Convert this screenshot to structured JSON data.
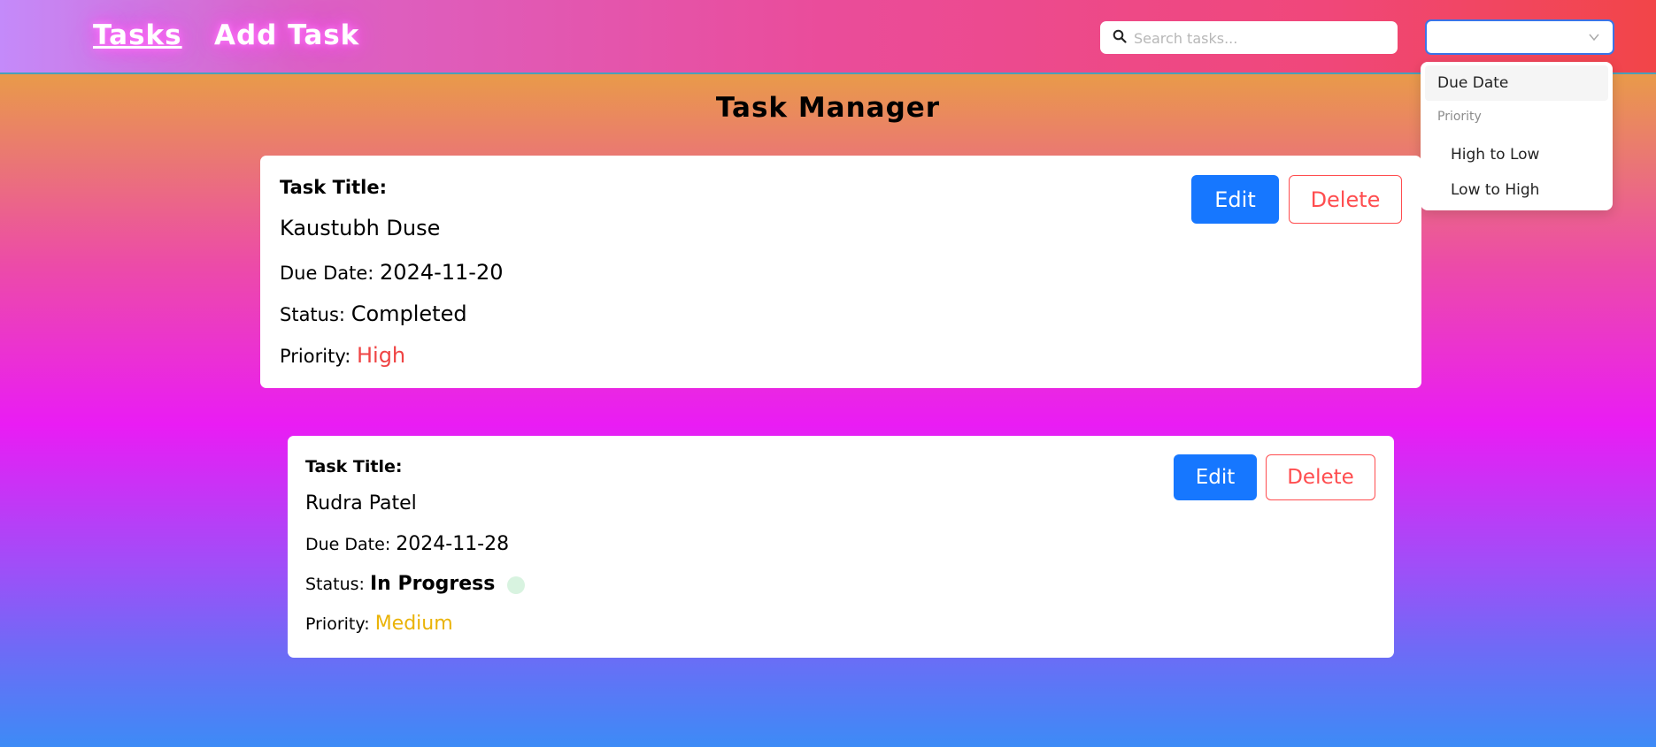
{
  "nav": {
    "links": [
      {
        "label": "Tasks",
        "active": true
      },
      {
        "label": "Add Task",
        "active": false
      }
    ]
  },
  "search": {
    "placeholder": "Search tasks...",
    "value": ""
  },
  "sort": {
    "selected": "",
    "options": {
      "due_date": "Due Date",
      "group_label": "Priority",
      "high_to_low": "High to Low",
      "low_to_high": "Low to High"
    }
  },
  "page": {
    "title": "Task Manager"
  },
  "tasks": [
    {
      "title_label": "Task Title:",
      "title": "Kaustubh Duse",
      "due_label": "Due Date:",
      "due_date": "2024-11-20",
      "status_label": "Status:",
      "status": "Completed",
      "priority_label": "Priority:",
      "priority": "High",
      "priority_color": "#ef4444",
      "edit_label": "Edit",
      "delete_label": "Delete"
    },
    {
      "title_label": "Task Title:",
      "title": "Rudra Patel",
      "due_label": "Due Date:",
      "due_date": "2024-11-28",
      "status_label": "Status:",
      "status": "In Progress",
      "priority_label": "Priority:",
      "priority": "Medium",
      "priority_color": "#eab308",
      "edit_label": "Edit",
      "delete_label": "Delete"
    }
  ],
  "colors": {
    "primary": "#1677ff",
    "danger": "#ff4d4f"
  }
}
